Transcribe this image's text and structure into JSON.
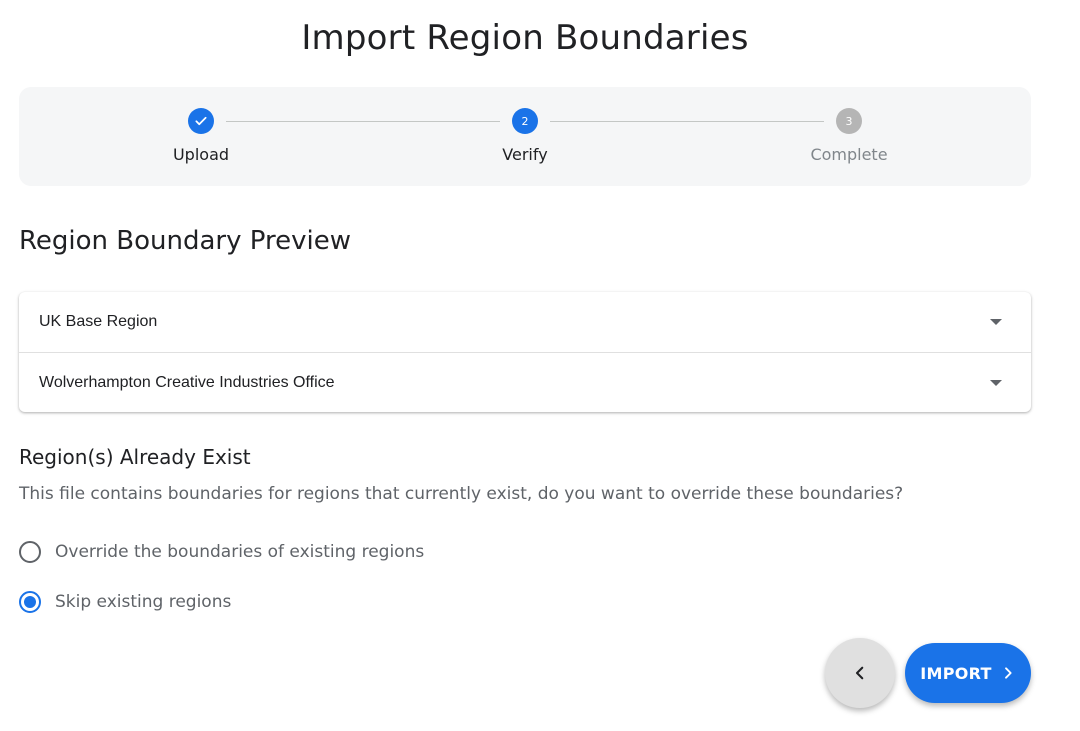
{
  "page": {
    "title": "Import Region Boundaries"
  },
  "stepper": {
    "steps": [
      {
        "label": "Upload",
        "number": "1",
        "state": "done"
      },
      {
        "label": "Verify",
        "number": "2",
        "state": "active"
      },
      {
        "label": "Complete",
        "number": "3",
        "state": "pending"
      }
    ]
  },
  "preview": {
    "title": "Region Boundary Preview",
    "regions": [
      {
        "label": "UK Base Region"
      },
      {
        "label": "Wolverhampton Creative Industries Office"
      }
    ]
  },
  "existing": {
    "title": "Region(s) Already Exist",
    "description": "This file contains boundaries for regions that currently exist, do you want to override these boundaries?",
    "options": [
      {
        "label": "Override the boundaries of existing regions",
        "checked": false
      },
      {
        "label": "Skip existing regions",
        "checked": true
      }
    ]
  },
  "actions": {
    "import_label": "IMPORT"
  },
  "colors": {
    "accent": "#1a73e8",
    "pending_step": "#b5b5b5",
    "back_button": "#e0e0e0"
  },
  "icons": {
    "done_step": "check-icon",
    "expand": "caret-down-icon",
    "back": "chevron-left-icon",
    "import": "chevron-right-icon"
  }
}
